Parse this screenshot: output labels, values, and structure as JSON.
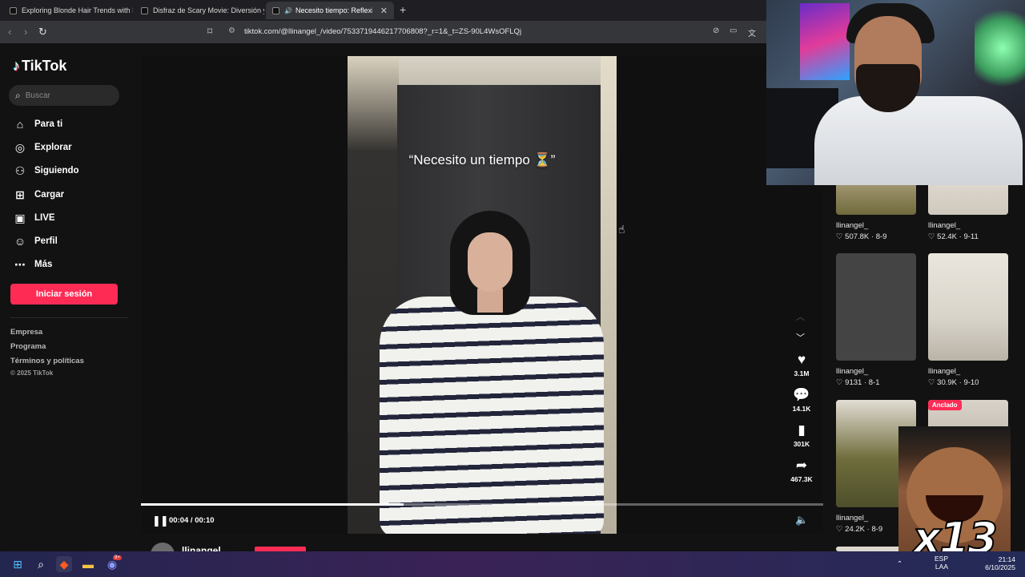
{
  "browser": {
    "tabs": [
      {
        "title": "Exploring Blonde Hair Trends with Br"
      },
      {
        "title": "Disfraz de Scary Movie: Diversión y C"
      },
      {
        "title": "Necesito tiempo: Reflexiones"
      }
    ],
    "new_tab_glyph": "+",
    "url": "tiktok.com/@llinangel_/video/7533719446217706808?_r=1&_t=ZS-90L4WsOFLQj"
  },
  "tiktok": {
    "logo_text": "TikTok",
    "search_placeholder": "Buscar",
    "nav": [
      {
        "label": "Para ti",
        "icon": "home-icon"
      },
      {
        "label": "Explorar",
        "icon": "compass-icon"
      },
      {
        "label": "Siguiendo",
        "icon": "following-icon"
      },
      {
        "label": "Cargar",
        "icon": "upload-icon"
      },
      {
        "label": "LIVE",
        "icon": "live-icon"
      },
      {
        "label": "Perfil",
        "icon": "profile-icon"
      },
      {
        "label": "Más",
        "icon": "more-icon"
      }
    ],
    "login_label": "Iniciar sesión",
    "footer_links": [
      "Empresa",
      "Programa",
      "Términos y políticas"
    ],
    "copyright": "© 2025 TikTok"
  },
  "video": {
    "caption_overlay": "“Necesito un tiempo ⏳”",
    "current_time": "00:04",
    "duration": "00:10",
    "time_display": "00:04 / 00:10",
    "progress": 0.385,
    "likes": "3.1M",
    "comments": "14.1K",
    "saves": "301K",
    "shares": "467.3K",
    "author": "llinangel_"
  },
  "related": [
    {
      "user": "llinangel_",
      "likes": "507.8K",
      "date": "8-9",
      "pinned": false
    },
    {
      "user": "llinangel_",
      "likes": "52.4K",
      "date": "9-11",
      "pinned": false
    },
    {
      "user": "llinangel_",
      "likes": "9131",
      "date": "8-1",
      "pinned": false
    },
    {
      "user": "llinangel_",
      "likes": "30.9K",
      "date": "9-10",
      "pinned": false
    },
    {
      "user": "llinangel_",
      "likes": "24.2K",
      "date": "8-9",
      "pinned": false
    },
    {
      "user": "",
      "likes": "",
      "date": "",
      "pinned": true,
      "badge": "Anclado"
    }
  ],
  "overlay": {
    "meme_text": "x13"
  },
  "taskbar": {
    "lang_top": "ESP",
    "lang_bottom": "LAA",
    "time": "21:14",
    "date": "6/10/2025",
    "discord_badge": "9+"
  },
  "colors": {
    "accent": "#fe2c55",
    "page_bg": "#121212",
    "tab_active": "#35363a"
  }
}
